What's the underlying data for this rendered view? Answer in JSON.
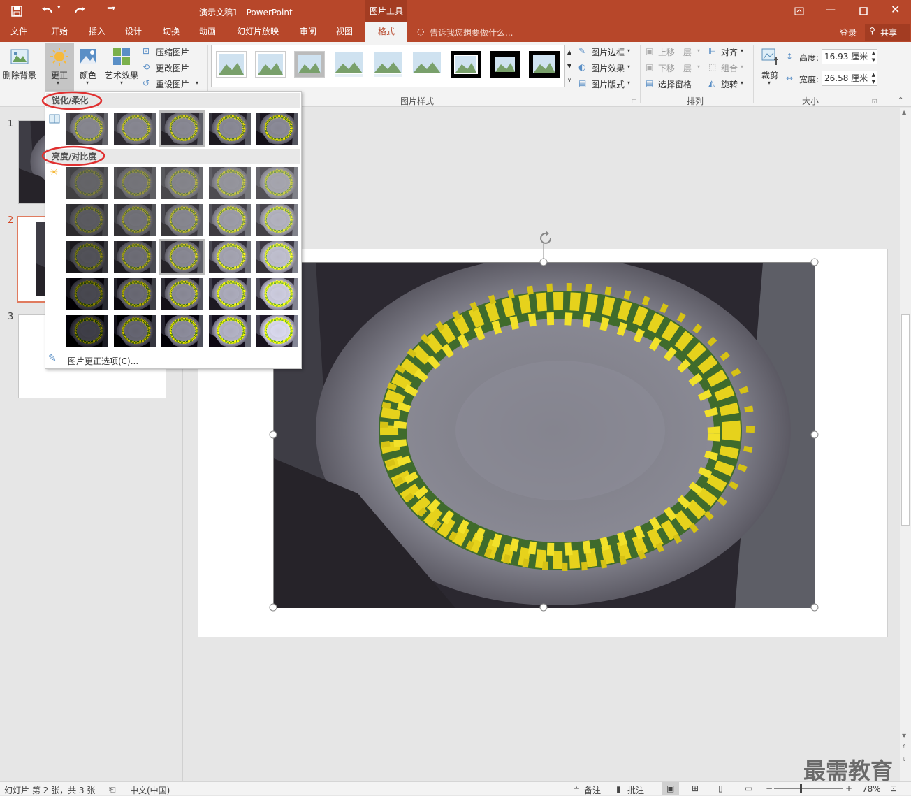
{
  "title_bar": {
    "doc_title": "演示文稿1 - PowerPoint",
    "context_tab": "图片工具",
    "save_icon": "save-icon",
    "undo_icon": "undo-icon",
    "redo_icon": "redo-icon"
  },
  "tabs": [
    {
      "label": "文件"
    },
    {
      "label": "开始"
    },
    {
      "label": "插入"
    },
    {
      "label": "设计"
    },
    {
      "label": "切换"
    },
    {
      "label": "动画"
    },
    {
      "label": "幻灯片放映"
    },
    {
      "label": "审阅"
    },
    {
      "label": "视图"
    },
    {
      "label": "格式"
    }
  ],
  "tell_me": "告诉我您想要做什么...",
  "account": {
    "signin": "登录",
    "share": "共享"
  },
  "ribbon": {
    "remove_bg": "删除背景",
    "corrections": "更正",
    "color": "颜色",
    "artistic": "艺术效果",
    "compress": "压缩图片",
    "change": "更改图片",
    "reset": "重设图片",
    "picture_styles_group": "图片样式",
    "border": "图片边框",
    "effects": "图片效果",
    "layout": "图片版式",
    "bring_forward": "上移一层",
    "send_backward": "下移一层",
    "selection_pane": "选择窗格",
    "align": "对齐",
    "group": "组合",
    "rotate": "旋转",
    "arrange_group": "排列",
    "crop": "裁剪",
    "height_label": "高度:",
    "height_value": "16.93 厘米",
    "width_label": "宽度:",
    "width_value": "26.58 厘米",
    "size_group": "大小"
  },
  "dropdown": {
    "sharpen_header": "锐化/柔化",
    "brightness_header": "亮度/对比度",
    "options_link": "图片更正选项(C)..."
  },
  "slides": [
    {
      "num": "1"
    },
    {
      "num": "2"
    },
    {
      "num": "3"
    }
  ],
  "status": {
    "slide_info": "幻灯片 第 2 张，共 3 张",
    "language": "中文(中国)",
    "notes": "备注",
    "comments": "批注",
    "zoom": "78%"
  },
  "watermark": "最需教育",
  "colors": {
    "accent": "#b7472a",
    "highlight_circle": "#e03030"
  }
}
